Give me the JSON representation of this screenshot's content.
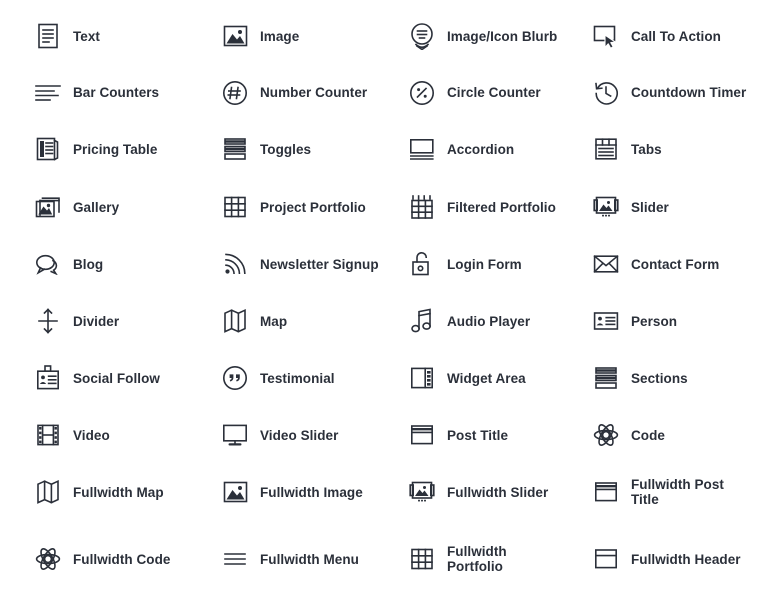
{
  "page": {
    "title": "Divi Module Icons Grid",
    "background_color": "#ffffff",
    "text_color": "#2b303a",
    "columns": 4,
    "rows": 10
  },
  "modules": [
    {
      "label": "Text",
      "icon": "document-text-icon",
      "row": 1,
      "col": 1
    },
    {
      "label": "Image",
      "icon": "image-icon",
      "row": 1,
      "col": 2
    },
    {
      "label": "Image/Icon Blurb",
      "icon": "blurb-speech-badge-icon",
      "row": 1,
      "col": 3
    },
    {
      "label": "Call To Action",
      "icon": "cursor-click-box-icon",
      "row": 1,
      "col": 4
    },
    {
      "label": "Bar Counters",
      "icon": "bar-counters-icon",
      "row": 2,
      "col": 1
    },
    {
      "label": "Number Counter",
      "icon": "hash-circle-icon",
      "row": 2,
      "col": 2
    },
    {
      "label": "Circle Counter",
      "icon": "percent-circle-icon",
      "row": 2,
      "col": 3
    },
    {
      "label": "Countdown Timer",
      "icon": "clock-rewind-icon",
      "row": 2,
      "col": 4
    },
    {
      "label": "Pricing Table",
      "icon": "pricing-table-icon",
      "row": 3,
      "col": 1
    },
    {
      "label": "Toggles",
      "icon": "toggles-stack-icon",
      "row": 3,
      "col": 2
    },
    {
      "label": "Accordion",
      "icon": "accordion-panel-icon",
      "row": 3,
      "col": 3
    },
    {
      "label": "Tabs",
      "icon": "tabs-icon",
      "row": 3,
      "col": 4
    },
    {
      "label": "Gallery",
      "icon": "gallery-stack-icon",
      "row": 4,
      "col": 1
    },
    {
      "label": "Project Portfolio",
      "icon": "grid-table-icon",
      "row": 4,
      "col": 2
    },
    {
      "label": "Filtered Portfolio",
      "icon": "filtered-grid-icon",
      "row": 4,
      "col": 3
    },
    {
      "label": "Slider",
      "icon": "slider-image-icon",
      "row": 4,
      "col": 4
    },
    {
      "label": "Blog",
      "icon": "speech-bubbles-icon",
      "row": 5,
      "col": 1
    },
    {
      "label": "Newsletter Signup",
      "icon": "rss-signal-icon",
      "row": 5,
      "col": 2
    },
    {
      "label": "Login Form",
      "icon": "padlock-open-icon",
      "row": 5,
      "col": 3
    },
    {
      "label": "Contact Form",
      "icon": "envelope-icon",
      "row": 5,
      "col": 4
    },
    {
      "label": "Divider",
      "icon": "vertical-arrows-divider-icon",
      "row": 6,
      "col": 1
    },
    {
      "label": "Map",
      "icon": "folded-map-icon",
      "row": 6,
      "col": 2
    },
    {
      "label": "Audio Player",
      "icon": "music-note-icon",
      "row": 6,
      "col": 3
    },
    {
      "label": "Person",
      "icon": "id-card-icon",
      "row": 6,
      "col": 4
    },
    {
      "label": "Social Follow",
      "icon": "badge-id-clip-icon",
      "row": 7,
      "col": 1
    },
    {
      "label": "Testimonial",
      "icon": "quote-circle-icon",
      "row": 7,
      "col": 2
    },
    {
      "label": "Widget Area",
      "icon": "sidebar-widget-icon",
      "row": 7,
      "col": 3
    },
    {
      "label": "Sections",
      "icon": "sections-stack-icon",
      "row": 7,
      "col": 4
    },
    {
      "label": "Video",
      "icon": "film-strip-icon",
      "row": 8,
      "col": 1
    },
    {
      "label": "Video Slider",
      "icon": "monitor-icon",
      "row": 8,
      "col": 2
    },
    {
      "label": "Post Title",
      "icon": "post-title-box-icon",
      "row": 8,
      "col": 3
    },
    {
      "label": "Code",
      "icon": "atom-code-icon",
      "row": 8,
      "col": 4
    },
    {
      "label": "Fullwidth Map",
      "icon": "folded-map-icon",
      "row": 9,
      "col": 1
    },
    {
      "label": "Fullwidth Image",
      "icon": "image-icon",
      "row": 9,
      "col": 2
    },
    {
      "label": "Fullwidth Slider",
      "icon": "slider-image-icon",
      "row": 9,
      "col": 3
    },
    {
      "label": "Fullwidth Post\nTitle",
      "icon": "post-title-box-icon",
      "row": 9,
      "col": 4
    },
    {
      "label": "Fullwidth Code",
      "icon": "atom-code-icon",
      "row": 10,
      "col": 1
    },
    {
      "label": "Fullwidth Menu",
      "icon": "hamburger-menu-icon",
      "row": 10,
      "col": 2
    },
    {
      "label": "Fullwidth\nPortfolio",
      "icon": "grid-table-icon",
      "row": 10,
      "col": 3
    },
    {
      "label": "Fullwidth Header",
      "icon": "header-box-icon",
      "row": 10,
      "col": 4
    }
  ]
}
